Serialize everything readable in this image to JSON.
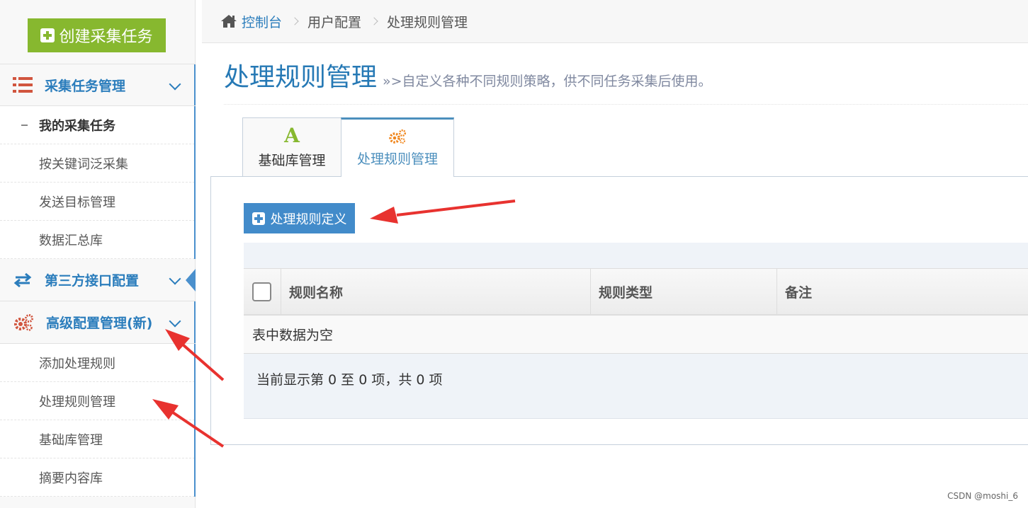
{
  "sidebar": {
    "create_label": "创建采集任务",
    "groups": [
      {
        "title": "采集任务管理",
        "icon": "list-icon",
        "items": [
          "我的采集任务",
          "按关键词泛采集",
          "发送目标管理",
          "数据汇总库"
        ]
      },
      {
        "title": "第三方接口配置",
        "icon": "swap-icon",
        "items": []
      },
      {
        "title": "高级配置管理(新)",
        "icon": "gears-icon",
        "items": [
          "添加处理规则",
          "处理规则管理",
          "基础库管理",
          "摘要内容库"
        ]
      }
    ]
  },
  "breadcrumb": {
    "home": "控制台",
    "level2": "用户配置",
    "level3": "处理规则管理"
  },
  "header": {
    "title": "处理规则管理",
    "description": "»>自定义各种不同规则策略，供不同任务采集后使用。"
  },
  "tabs": [
    {
      "label": "基础库管理",
      "icon": "letter-a-icon"
    },
    {
      "label": "处理规则管理",
      "icon": "gears-icon"
    }
  ],
  "toolbar": {
    "add_label": "处理规则定义"
  },
  "table": {
    "columns": [
      "规则名称",
      "规则类型",
      "备注"
    ],
    "empty_text": "表中数据为空",
    "info_text": "当前显示第 0 至 0 项，共 0 项"
  },
  "watermark": "CSDN @moshi_6",
  "colors": {
    "green": "#87b82f",
    "blue": "#2b7dbc",
    "button_blue": "#428bca",
    "red_arrow": "#e8322f"
  }
}
